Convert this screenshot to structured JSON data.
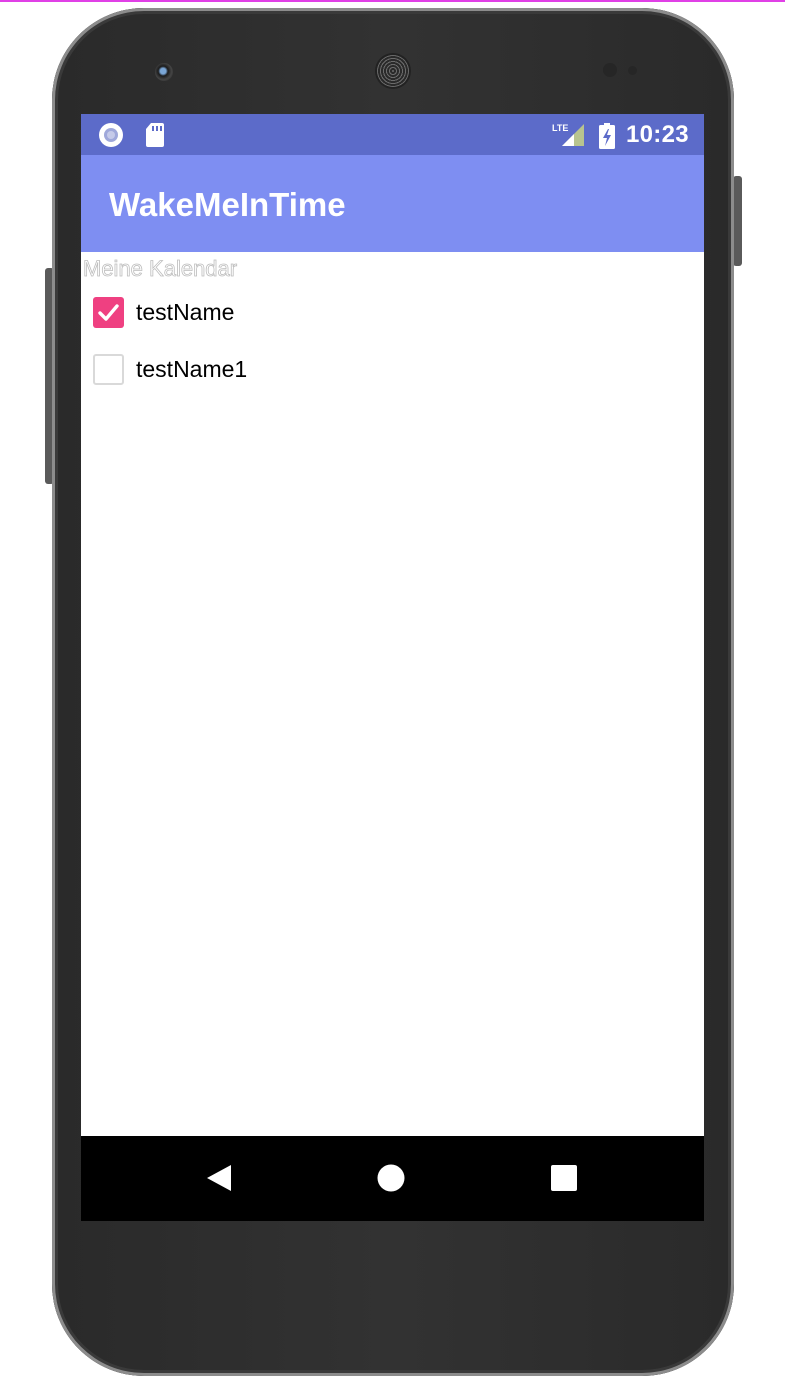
{
  "status_bar": {
    "time": "10:23",
    "network_label": "LTE",
    "icons": [
      "circle-notification-icon",
      "sd-card-icon",
      "lte-signal-icon",
      "battery-charging-icon"
    ]
  },
  "app_bar": {
    "title": "WakeMeInTime"
  },
  "calendar_section": {
    "label": "Meine Kalendar",
    "items": [
      {
        "name": "testName",
        "checked": true
      },
      {
        "name": "testName1",
        "checked": false
      }
    ]
  },
  "nav_bar": {
    "icons": [
      "back-icon",
      "home-icon",
      "recents-icon"
    ]
  },
  "colors": {
    "status_bar": "#5c6bc9",
    "app_bar": "#7e8ef2",
    "accent": "#ef4081",
    "device_body": "#2e2e2e"
  }
}
